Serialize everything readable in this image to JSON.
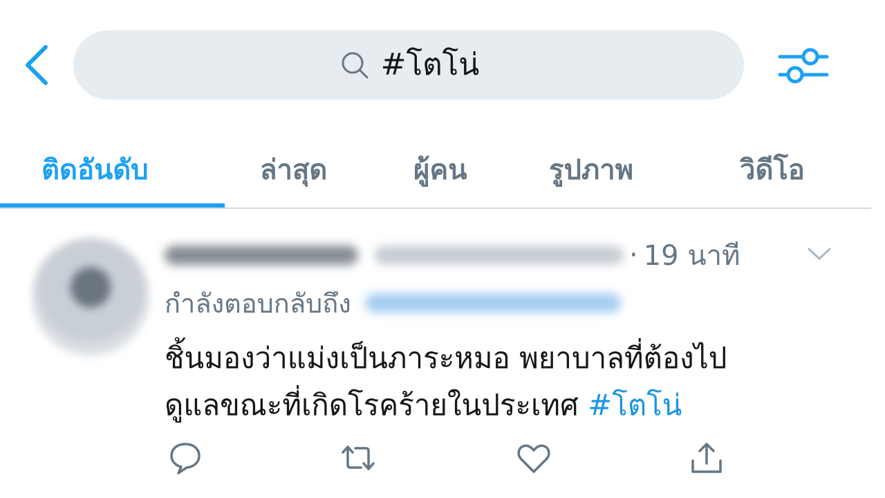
{
  "search": {
    "query": "#โตโน่"
  },
  "icons": {
    "back": "chevron-left-icon",
    "search": "search-icon",
    "filter": "sliders-icon",
    "caret": "chevron-down-icon",
    "reply": "comment-icon",
    "retweet": "retweet-icon",
    "like": "heart-icon",
    "share": "share-icon"
  },
  "colors": {
    "accent": "#1da1f2",
    "muted": "#657786",
    "search_bg": "#e6ecf0",
    "hashtag": "#1b95e0"
  },
  "tabs": [
    {
      "label": "ติดอันดับ",
      "active": true
    },
    {
      "label": "ล่าสุด",
      "active": false
    },
    {
      "label": "ผู้คน",
      "active": false
    },
    {
      "label": "รูปภาพ",
      "active": false
    },
    {
      "label": "วิดีโอ",
      "active": false
    }
  ],
  "tweet": {
    "separator": "·",
    "time": "19 นาที",
    "reply_label": "กำลังตอบกลับถึง",
    "text_line1": "ชิ้นมองว่าแม่งเป็นภาระหมอ พยาบาลที่ต้องไป",
    "text_line2_plain": "ดูแลขณะที่เกิดโรคร้ายในประเทศ ",
    "text_line2_hashtag": "#โตโน่"
  }
}
